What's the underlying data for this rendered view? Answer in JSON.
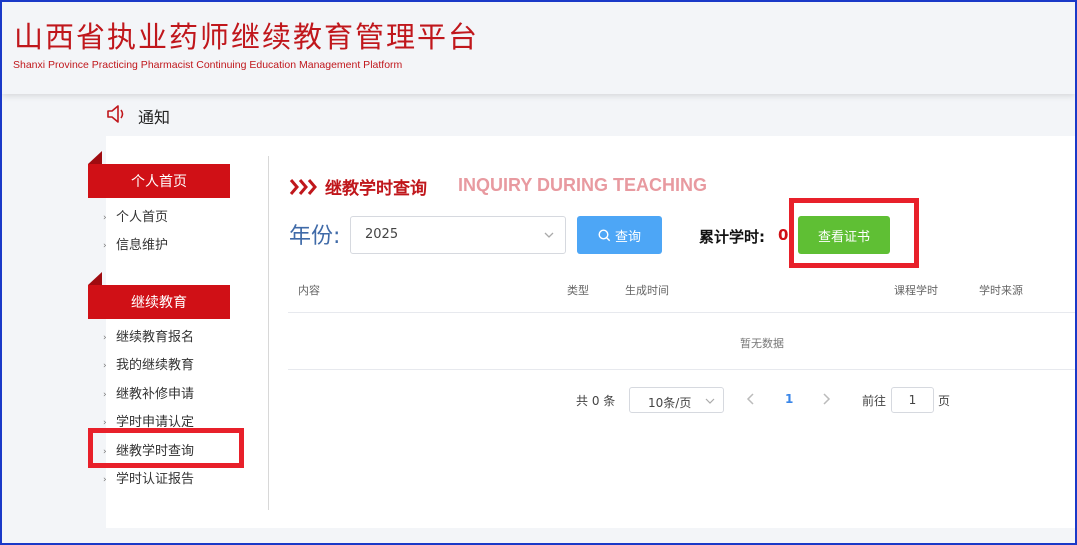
{
  "header": {
    "title": "山西省执业药师继续教育管理平台",
    "subtitle": "Shanxi Province Practicing Pharmacist Continuing Education Management Platform"
  },
  "notice": {
    "label": "通知"
  },
  "sidebar": {
    "sections": [
      {
        "title": "个人首页",
        "items": [
          "个人首页",
          "信息维护"
        ]
      },
      {
        "title": "继续教育",
        "items": [
          "继续教育报名",
          "我的继续教育",
          "继教补修申请",
          "学时申请认定",
          "继教学时查询",
          "学时认证报告"
        ]
      }
    ]
  },
  "main": {
    "title": "继教学时查询",
    "title_en": "INQUIRY DURING TEACHING",
    "year_label": "年份:",
    "year_value": "2025",
    "query_button": "查询",
    "total_label": "累计学时:",
    "total_value": "0",
    "cert_button": "查看证书",
    "table": {
      "columns": [
        "内容",
        "类型",
        "生成时间",
        "课程学时",
        "学时来源"
      ],
      "empty_text": "暂无数据"
    },
    "pagination": {
      "total": "共 0 条",
      "page_size": "10条/页",
      "current_page": "1",
      "goto_label": "前往",
      "goto_value": "1",
      "page_suffix": "页"
    }
  },
  "colors": {
    "brand_red": "#c0171c",
    "sidebar_tab": "#d01016",
    "query_blue": "#4da6f6",
    "cert_green": "#5fbf34",
    "highlight_box": "#e8202a"
  },
  "icons": [
    "speaker-icon",
    "triple-chevron-icon",
    "chevron-down-icon",
    "search-icon",
    "chevron-left-icon",
    "chevron-right-icon"
  ]
}
